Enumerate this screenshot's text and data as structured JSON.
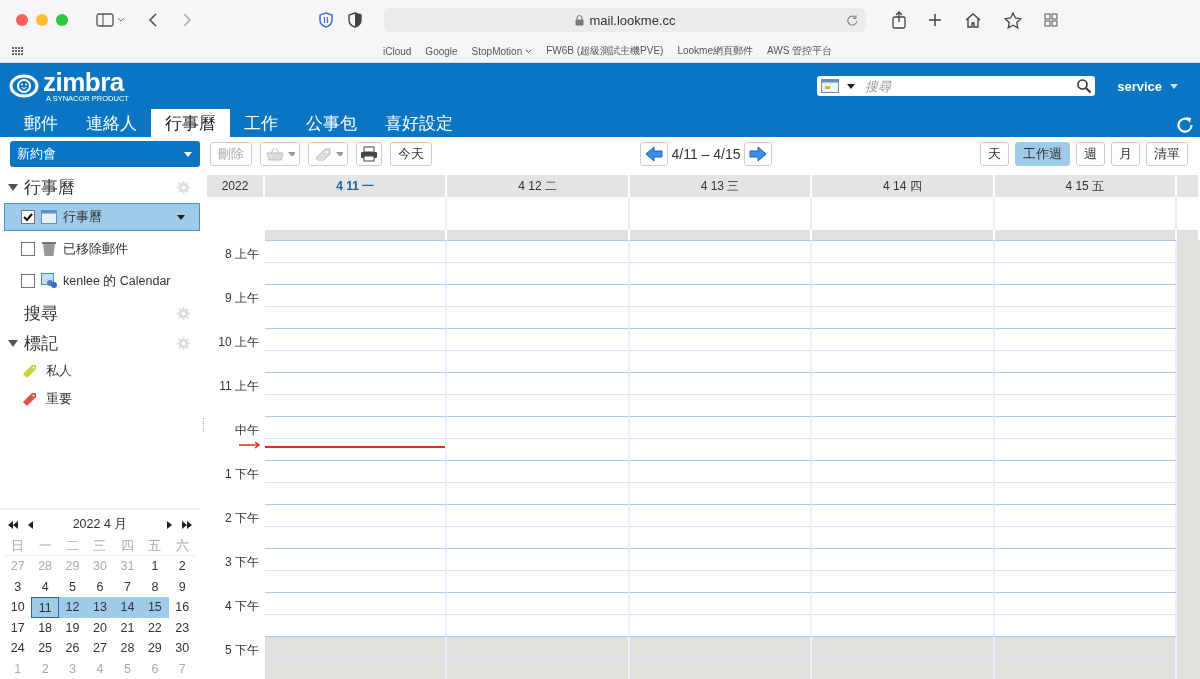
{
  "browser": {
    "url": "mail.lookme.cc",
    "bookmarks": [
      {
        "label": "iCloud",
        "folder": false
      },
      {
        "label": "Google",
        "folder": false
      },
      {
        "label": "StopMotion",
        "folder": true
      },
      {
        "label": "FW6B (超級測試主機PVE)",
        "folder": false
      },
      {
        "label": "Lookme網頁郵件",
        "folder": false
      },
      {
        "label": "AWS 管控平台",
        "folder": false
      }
    ]
  },
  "header": {
    "logo": "zimbra",
    "tagline": "A SYNACOR PRODUCT",
    "search": {
      "placeholder": "搜尋"
    },
    "user": "service"
  },
  "tabs": [
    {
      "label": "郵件",
      "selected": false
    },
    {
      "label": "連絡人",
      "selected": false
    },
    {
      "label": "行事曆",
      "selected": true
    },
    {
      "label": "工作",
      "selected": false
    },
    {
      "label": "公事包",
      "selected": false
    },
    {
      "label": "喜好設定",
      "selected": false
    }
  ],
  "toolbar": {
    "new_button": "新約會",
    "delete_button": {
      "label": "刪除",
      "disabled": true
    },
    "today_button": "今天",
    "date_range": "4/11 – 4/15",
    "views": [
      {
        "label": "天",
        "selected": false
      },
      {
        "label": "工作週",
        "selected": true
      },
      {
        "label": "週",
        "selected": false
      },
      {
        "label": "月",
        "selected": false
      },
      {
        "label": "清單",
        "selected": false
      }
    ]
  },
  "sidebar": {
    "calendars": {
      "title": "行事曆",
      "expanded": true,
      "items": [
        {
          "label": "行事曆",
          "kind": "calendar",
          "checked": true,
          "selected": true
        },
        {
          "label": "已移除郵件",
          "kind": "trash",
          "checked": false,
          "selected": false
        },
        {
          "label": "kenlee 的 Calendar",
          "kind": "shared",
          "checked": false,
          "selected": false
        }
      ]
    },
    "search": {
      "title": "搜尋"
    },
    "tags": {
      "title": "標記",
      "expanded": true,
      "items": [
        {
          "label": "私人",
          "color": "#c8d23c"
        },
        {
          "label": "重要",
          "color": "#d9534f"
        }
      ]
    }
  },
  "mini_calendar": {
    "title": "2022 4 月",
    "weekdays": [
      "日",
      "一",
      "二",
      "三",
      "四",
      "五",
      "六"
    ],
    "weeks": [
      [
        {
          "day": "27",
          "kind": "other",
          "selected": false,
          "today": false
        },
        {
          "day": "28",
          "kind": "other",
          "selected": false,
          "today": false
        },
        {
          "day": "29",
          "kind": "other",
          "selected": false,
          "today": false
        },
        {
          "day": "30",
          "kind": "other",
          "selected": false,
          "today": false
        },
        {
          "day": "31",
          "kind": "other",
          "selected": false,
          "today": false
        },
        {
          "day": "1",
          "kind": "current",
          "selected": false,
          "today": false
        },
        {
          "day": "2",
          "kind": "current",
          "selected": false,
          "today": false
        }
      ],
      [
        {
          "day": "3",
          "kind": "current",
          "selected": false,
          "today": false
        },
        {
          "day": "4",
          "kind": "current",
          "selected": false,
          "today": false
        },
        {
          "day": "5",
          "kind": "current",
          "selected": false,
          "today": false
        },
        {
          "day": "6",
          "kind": "current",
          "selected": false,
          "today": false
        },
        {
          "day": "7",
          "kind": "current",
          "selected": false,
          "today": false
        },
        {
          "day": "8",
          "kind": "current",
          "selected": false,
          "today": false
        },
        {
          "day": "9",
          "kind": "current",
          "selected": false,
          "today": false
        }
      ],
      [
        {
          "day": "10",
          "kind": "current",
          "selected": false,
          "today": false
        },
        {
          "day": "11",
          "kind": "current",
          "selected": true,
          "today": true
        },
        {
          "day": "12",
          "kind": "current",
          "selected": true,
          "today": false
        },
        {
          "day": "13",
          "kind": "current",
          "selected": true,
          "today": false
        },
        {
          "day": "14",
          "kind": "current",
          "selected": true,
          "today": false
        },
        {
          "day": "15",
          "kind": "current",
          "selected": true,
          "today": false
        },
        {
          "day": "16",
          "kind": "current",
          "selected": false,
          "today": false
        }
      ],
      [
        {
          "day": "17",
          "kind": "current",
          "selected": false,
          "today": false
        },
        {
          "day": "18",
          "kind": "current",
          "selected": false,
          "today": false
        },
        {
          "day": "19",
          "kind": "current",
          "selected": false,
          "today": false
        },
        {
          "day": "20",
          "kind": "current",
          "selected": false,
          "today": false
        },
        {
          "day": "21",
          "kind": "current",
          "selected": false,
          "today": false
        },
        {
          "day": "22",
          "kind": "current",
          "selected": false,
          "today": false
        },
        {
          "day": "23",
          "kind": "current",
          "selected": false,
          "today": false
        }
      ],
      [
        {
          "day": "24",
          "kind": "current",
          "selected": false,
          "today": false
        },
        {
          "day": "25",
          "kind": "current",
          "selected": false,
          "today": false
        },
        {
          "day": "26",
          "kind": "current",
          "selected": false,
          "today": false
        },
        {
          "day": "27",
          "kind": "current",
          "selected": false,
          "today": false
        },
        {
          "day": "28",
          "kind": "current",
          "selected": false,
          "today": false
        },
        {
          "day": "29",
          "kind": "current",
          "selected": false,
          "today": false
        },
        {
          "day": "30",
          "kind": "current",
          "selected": false,
          "today": false
        }
      ],
      [
        {
          "day": "1",
          "kind": "other",
          "selected": false,
          "today": false
        },
        {
          "day": "2",
          "kind": "other",
          "selected": false,
          "today": false
        },
        {
          "day": "3",
          "kind": "other",
          "selected": false,
          "today": false
        },
        {
          "day": "4",
          "kind": "other",
          "selected": false,
          "today": false
        },
        {
          "day": "5",
          "kind": "other",
          "selected": false,
          "today": false
        },
        {
          "day": "6",
          "kind": "other",
          "selected": false,
          "today": false
        },
        {
          "day": "7",
          "kind": "other",
          "selected": false,
          "today": false
        }
      ]
    ]
  },
  "calendar": {
    "year": "2022",
    "days": [
      {
        "label": "4 11 一",
        "today": true
      },
      {
        "label": "4 12 二",
        "today": false
      },
      {
        "label": "4 13 三",
        "today": false
      },
      {
        "label": "4 14 四",
        "today": false
      },
      {
        "label": "4 15 五",
        "today": false
      }
    ],
    "hours": [
      {
        "label": "8 上午",
        "off_hours": false
      },
      {
        "label": "9 上午",
        "off_hours": false
      },
      {
        "label": "10 上午",
        "off_hours": false
      },
      {
        "label": "11 上午",
        "off_hours": false
      },
      {
        "label": "中午",
        "off_hours": false
      },
      {
        "label": "1 下午",
        "off_hours": false
      },
      {
        "label": "2 下午",
        "off_hours": false
      },
      {
        "label": "3 下午",
        "off_hours": false
      },
      {
        "label": "4 下午",
        "off_hours": false
      },
      {
        "label": "5 下午",
        "off_hours": true
      }
    ]
  }
}
